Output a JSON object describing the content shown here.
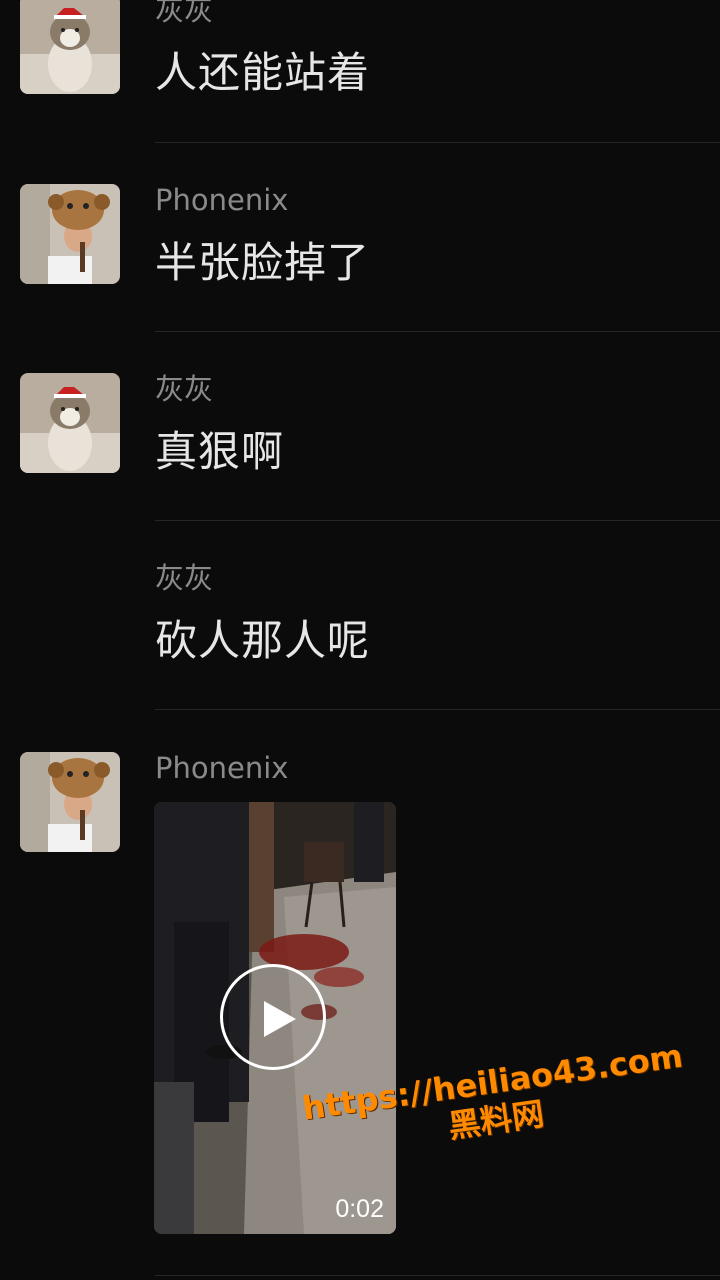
{
  "messages": [
    {
      "sender": "灰灰",
      "text": "人还能站着",
      "avatar": "cat-avatar"
    },
    {
      "sender": "Phonenix",
      "text": "半张脸掉了",
      "avatar": "boy-bear-hat-avatar"
    },
    {
      "sender": "灰灰",
      "text": "真狠啊",
      "avatar": "cat-avatar"
    },
    {
      "sender": "灰灰",
      "text": "砍人那人呢",
      "avatar": ""
    },
    {
      "sender": "Phonenix",
      "avatar": "boy-bear-hat-avatar",
      "video": {
        "duration": "0:02"
      }
    }
  ],
  "watermark": {
    "url": "https://heiliao43.com",
    "name": "黑料网",
    "color": "#ff8a00"
  },
  "colors": {
    "background": "#0b0b0c",
    "sender": "#8a8a8a",
    "text": "#e6e6e6",
    "divider": "#262626"
  }
}
